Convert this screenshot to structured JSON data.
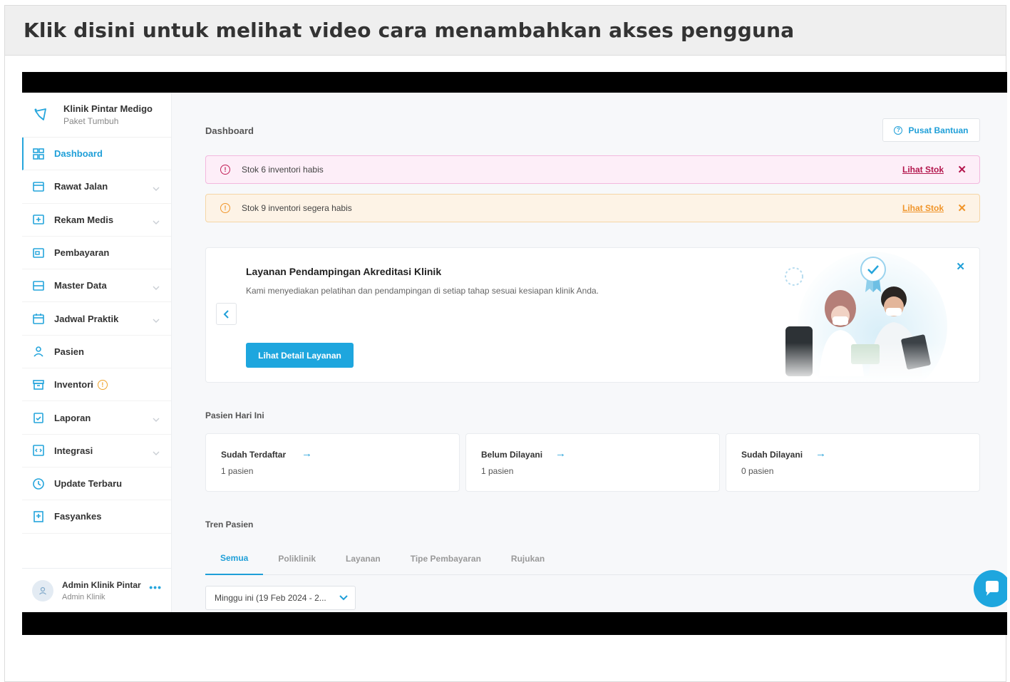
{
  "header": {
    "title": "Klik disini untuk melihat video cara menambahkan akses pengguna"
  },
  "brand": {
    "name": "Klinik Pintar Medigo",
    "plan": "Paket Tumbuh",
    "icon": "clinic-logo-icon"
  },
  "sidebar": {
    "items": [
      {
        "label": "Dashboard",
        "icon": "dashboard-icon",
        "active": true
      },
      {
        "label": "Rawat Jalan",
        "icon": "outpatient-icon",
        "chevron": true
      },
      {
        "label": "Rekam Medis",
        "icon": "medical-record-icon",
        "chevron": true
      },
      {
        "label": "Pembayaran",
        "icon": "payment-icon"
      },
      {
        "label": "Master Data",
        "icon": "database-icon",
        "chevron": true
      },
      {
        "label": "Jadwal Praktik",
        "icon": "calendar-icon",
        "chevron": true
      },
      {
        "label": "Pasien",
        "icon": "user-icon"
      },
      {
        "label": "Inventori",
        "icon": "inventory-icon",
        "warning": "!"
      },
      {
        "label": "Laporan",
        "icon": "report-icon",
        "chevron": true
      },
      {
        "label": "Integrasi",
        "icon": "integration-icon",
        "chevron": true
      },
      {
        "label": "Update Terbaru",
        "icon": "update-icon"
      },
      {
        "label": "Fasyankes",
        "icon": "hospital-icon"
      }
    ]
  },
  "user": {
    "name": "Admin Klinik Pintar",
    "role": "Admin Klinik",
    "more": "•••"
  },
  "main": {
    "page_title": "Dashboard",
    "help_label": "Pusat Bantuan",
    "alerts": [
      {
        "text": "Stok 6 inventori habis",
        "link": "Lihat Stok",
        "color": "#c21e56"
      },
      {
        "text": "Stok 9 inventori segera habis",
        "link": "Lihat Stok",
        "color": "#f0952a"
      }
    ],
    "promo": {
      "title": "Layanan Pendampingan Akreditasi Klinik",
      "description": "Kami menyediakan pelatihan dan pendampingan di setiap tahap sesuai kesiapan klinik Anda.",
      "button": "Lihat Detail Layanan"
    },
    "today_label": "Pasien Hari Ini",
    "stats": [
      {
        "title": "Sudah Terdaftar",
        "value": "1 pasien"
      },
      {
        "title": "Belum Dilayani",
        "value": "1 pasien"
      },
      {
        "title": "Sudah Dilayani",
        "value": "0 pasien"
      }
    ],
    "trend_label": "Tren Pasien",
    "tabs": [
      "Semua",
      "Poliklinik",
      "Layanan",
      "Tipe Pembayaran",
      "Rujukan"
    ],
    "period_select": "Minggu ini (19 Feb 2024 - 2..."
  },
  "colors": {
    "accent": "#1ea6de",
    "danger": "#c21e56",
    "warning": "#f0952a"
  }
}
